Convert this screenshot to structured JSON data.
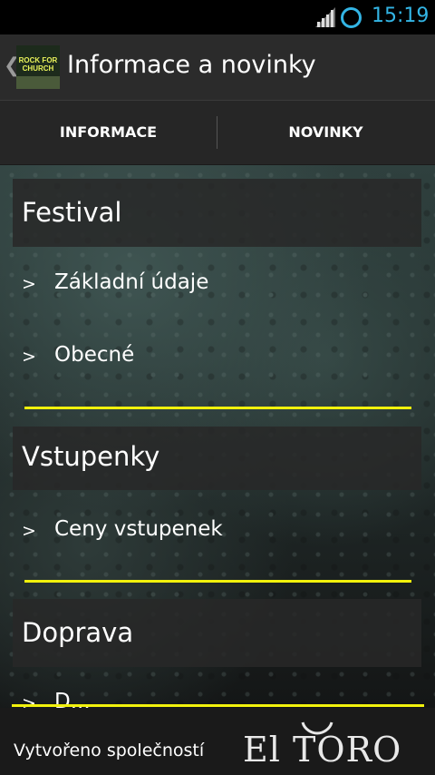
{
  "status_bar": {
    "time": "15:19",
    "colors": {
      "accent": "#33b5e5"
    },
    "icons": [
      "signal-icon",
      "sync-ring-icon"
    ]
  },
  "action_bar": {
    "title": "Informace a novinky",
    "app_icon": {
      "name": "rock-for-church-logo",
      "text": "ROCK FOR CHURCH"
    }
  },
  "tabs": [
    {
      "label": "INFORMACE",
      "selected": true
    },
    {
      "label": "NOVINKY",
      "selected": false
    }
  ],
  "sections": [
    {
      "title": "Festival",
      "items": [
        "Základní údaje",
        "Obecné"
      ]
    },
    {
      "title": "Vstupenky",
      "items": [
        "Ceny vstupenek"
      ]
    },
    {
      "title": "Doprava",
      "items": [
        "D..."
      ]
    }
  ],
  "item_caret": ">",
  "footer": {
    "text": "Vytvořeno společností",
    "brand": "El TORO"
  },
  "colors": {
    "accent_yellow": "#f1f10c",
    "background": "#1a1a1a"
  }
}
